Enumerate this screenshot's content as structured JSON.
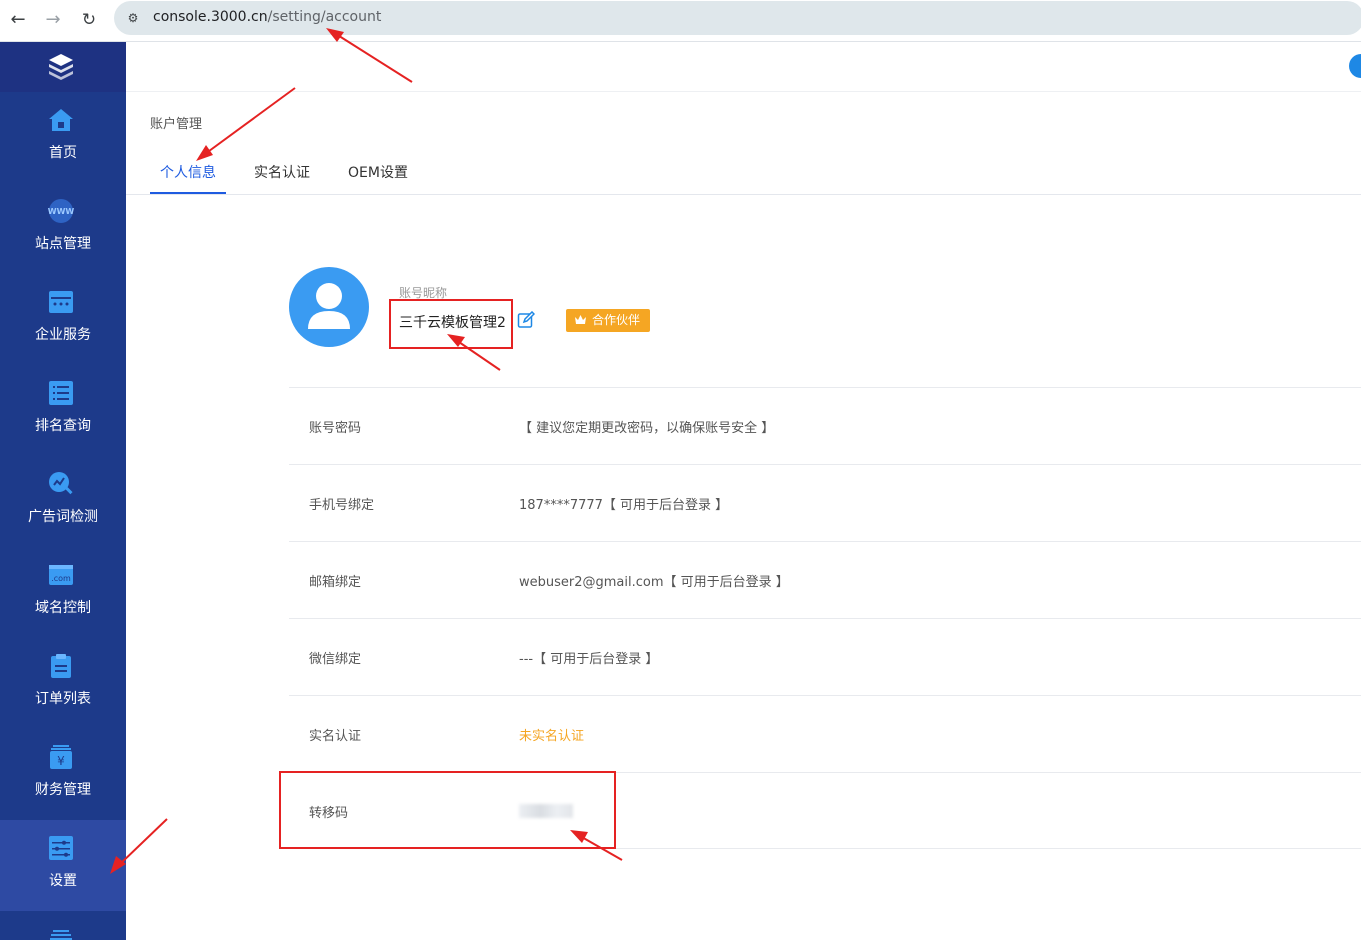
{
  "browser": {
    "url_domain": "console.3000.cn",
    "url_path": "/setting/account",
    "back_icon": "arrow-left-icon",
    "forward_icon": "arrow-right-icon",
    "reload_icon": "reload-icon"
  },
  "sidebar": {
    "items": [
      {
        "label": "首页",
        "icon": "home-icon"
      },
      {
        "label": "站点管理",
        "icon": "www-globe-icon"
      },
      {
        "label": "企业服务",
        "icon": "enterprise-service-icon"
      },
      {
        "label": "排名查询",
        "icon": "list-icon"
      },
      {
        "label": "广告词检测",
        "icon": "search-chart-icon"
      },
      {
        "label": "域名控制",
        "icon": "domain-com-icon"
      },
      {
        "label": "订单列表",
        "icon": "clipboard-icon"
      },
      {
        "label": "财务管理",
        "icon": "yen-icon"
      },
      {
        "label": "设置",
        "icon": "settings-sliders-icon"
      }
    ],
    "active_index": 8,
    "colors": {
      "bg": "#1d3a8a",
      "active": "#2e4aa3",
      "icon": "#3a9bf2"
    }
  },
  "main": {
    "breadcrumb": "账户管理",
    "tabs": [
      {
        "label": "个人信息",
        "active": true
      },
      {
        "label": "实名认证",
        "active": false
      },
      {
        "label": "OEM设置",
        "active": false
      }
    ],
    "profile": {
      "nickname_label": "账号昵称",
      "nickname": "三千云模板管理2",
      "badge": "合作伙伴"
    },
    "rows": [
      {
        "key": "账号密码",
        "value": "【 建议您定期更改密码，以确保账号安全 】"
      },
      {
        "key": "手机号绑定",
        "value": "187****7777【 可用于后台登录 】"
      },
      {
        "key": "邮箱绑定",
        "value": "webuser2@gmail.com【 可用于后台登录 】"
      },
      {
        "key": "微信绑定",
        "value": "---【 可用于后台登录 】"
      },
      {
        "key": "实名认证",
        "value": "未实名认证"
      },
      {
        "key": "转移码",
        "value": ""
      }
    ],
    "colors": {
      "accent": "#1e5be0",
      "badge": "#f5a623",
      "warning_text": "#f5a623"
    }
  },
  "annotations": {
    "color": "#e52222"
  }
}
